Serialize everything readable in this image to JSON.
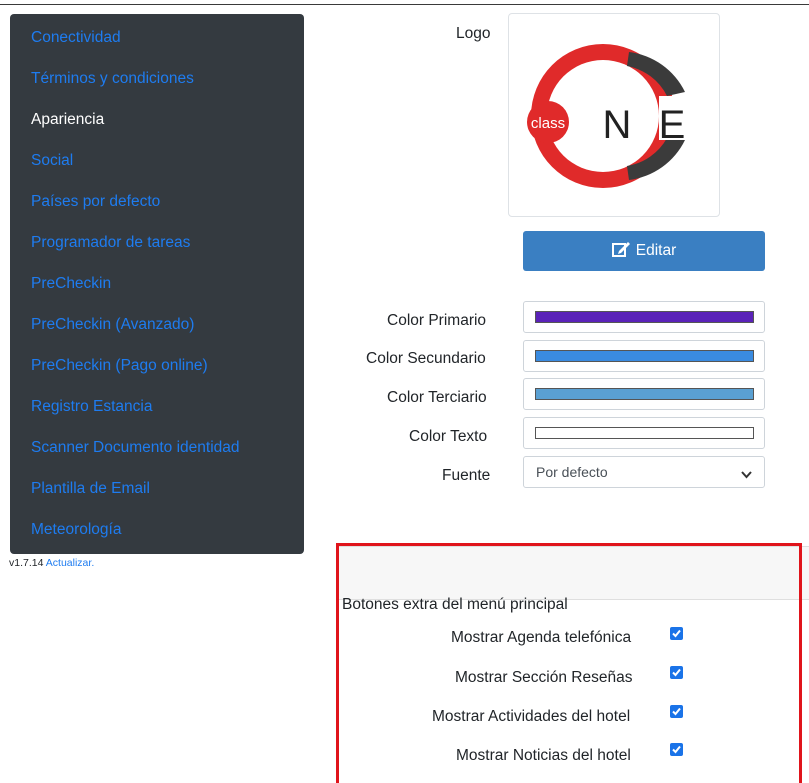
{
  "sidebar": {
    "items": [
      {
        "label": "Conectividad",
        "active": false
      },
      {
        "label": "Términos y condiciones",
        "active": false
      },
      {
        "label": "Apariencia",
        "active": true
      },
      {
        "label": "Social",
        "active": false
      },
      {
        "label": "Países por defecto",
        "active": false
      },
      {
        "label": "Programador de tareas",
        "active": false
      },
      {
        "label": "PreCheckin",
        "active": false
      },
      {
        "label": "PreCheckin (Avanzado)",
        "active": false
      },
      {
        "label": "PreCheckin (Pago online)",
        "active": false
      },
      {
        "label": "Registro Estancia",
        "active": false
      },
      {
        "label": "Scanner Documento identidad",
        "active": false
      },
      {
        "label": "Plantilla de Email",
        "active": false
      },
      {
        "label": "Meteorología",
        "active": false
      }
    ]
  },
  "footer": {
    "version": "v1.7.14",
    "update_link": "Actualizar."
  },
  "appearance": {
    "logo_label": "Logo",
    "logo_text": {
      "class": "class",
      "n": "N",
      "e": "E"
    },
    "edit_button": "Editar",
    "color_primary_label": "Color Primario",
    "color_primary": "#5a22b8",
    "color_secondary_label": "Color Secundario",
    "color_secondary": "#3a8be0",
    "color_tertiary_label": "Color Terciario",
    "color_tertiary": "#5aa0d2",
    "color_text_label": "Color Texto",
    "color_text": "#ffffff",
    "font_label": "Fuente",
    "font_value": "Por defecto"
  },
  "extra_buttons": {
    "title": "Botones extra del menú principal",
    "items": [
      {
        "label": "Mostrar Agenda telefónica",
        "checked": true
      },
      {
        "label": "Mostrar Sección Reseñas",
        "checked": true
      },
      {
        "label": "Mostrar Actividades del hotel",
        "checked": true
      },
      {
        "label": "Mostrar Noticias del hotel",
        "checked": true
      }
    ]
  },
  "icons": {
    "edit": "edit-icon",
    "chevron": "chevron-down-icon",
    "check": "check-icon"
  }
}
